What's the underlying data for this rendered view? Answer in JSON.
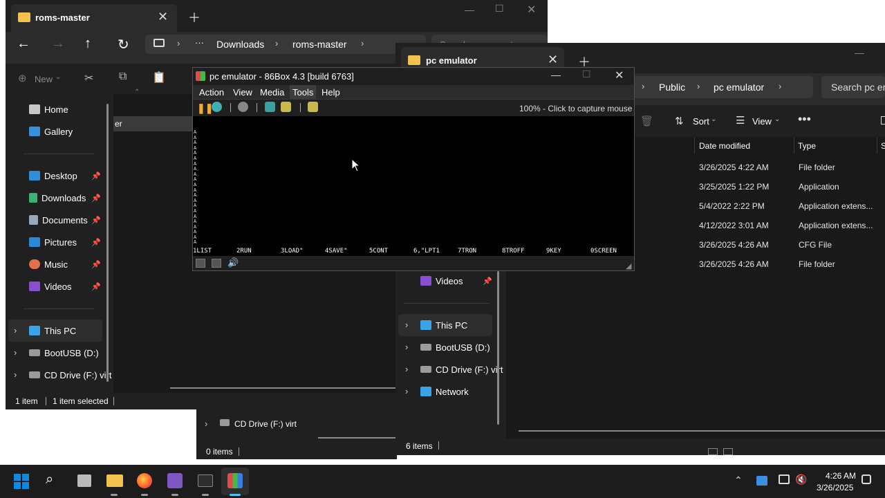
{
  "win1": {
    "tab_title": "roms-master",
    "breadcrumb": [
      "Downloads",
      "roms-master"
    ],
    "search_placeholder": "Search roms-master",
    "new_label": "New",
    "nav": [
      {
        "label": "Home",
        "pinned": false
      },
      {
        "label": "Gallery",
        "pinned": false
      },
      {
        "label": "Desktop",
        "pinned": true
      },
      {
        "label": "Downloads",
        "pinned": true
      },
      {
        "label": "Documents",
        "pinned": true
      },
      {
        "label": "Pictures",
        "pinned": true
      },
      {
        "label": "Music",
        "pinned": true
      },
      {
        "label": "Videos",
        "pinned": true
      },
      {
        "label": "This PC",
        "pinned": false
      },
      {
        "label": "BootUSB (D:)",
        "pinned": false
      },
      {
        "label": "CD Drive (F:) virt",
        "pinned": false
      }
    ],
    "partial_row": "er",
    "status_items": "1 item",
    "status_selected": "1 item selected"
  },
  "win_mid": {
    "cd_drive": "CD Drive (F:) virt",
    "status": "0 items"
  },
  "win2": {
    "tab_title": "pc emulator",
    "breadcrumb": [
      "Public",
      "pc emulator"
    ],
    "search_placeholder": "Search pc em",
    "sort_label": "Sort",
    "view_label": "View",
    "col_date": "Date modified",
    "col_type": "Type",
    "col_size": "S",
    "rows": [
      {
        "date": "3/26/2025 4:22 AM",
        "type": "File folder"
      },
      {
        "date": "3/25/2025 1:22 PM",
        "type": "Application"
      },
      {
        "date": "5/4/2022 2:22 PM",
        "type": "Application extens..."
      },
      {
        "date": "4/12/2022 3:01 AM",
        "type": "Application extens..."
      },
      {
        "date": "3/26/2025 4:26 AM",
        "type": "CFG File"
      },
      {
        "date": "3/26/2025 4:26 AM",
        "type": "File folder"
      }
    ],
    "nav": [
      {
        "label": "Videos"
      },
      {
        "label": "This PC"
      },
      {
        "label": "BootUSB (D:)"
      },
      {
        "label": "CD Drive (F:) virt"
      },
      {
        "label": "Network"
      }
    ],
    "status": "6 items"
  },
  "emu": {
    "title": "pc emulator - 86Box 4.3 [build 6763]",
    "menu": [
      "Action",
      "View",
      "Media",
      "Tools",
      "Help"
    ],
    "capture_text": "100% - Click to capture mouse",
    "fkeys": [
      "1LIST",
      "2RUN",
      "3LOAD\"",
      "4SAVE\"",
      "5CONT",
      "6,\"LPT1",
      "7TRON",
      "8TROFF",
      "9KEY",
      "0SCREEN"
    ],
    "screen_char": "A"
  },
  "taskbar": {
    "time": "4:26 AM",
    "date": "3/26/2025"
  },
  "colors": {
    "explorer_bg": "#191919",
    "accent": "#4cc2ff",
    "folder": "#f2c14e",
    "emu_menu_bg": "#2b2b2b",
    "taskbar_bg": "#1c1c1c"
  }
}
